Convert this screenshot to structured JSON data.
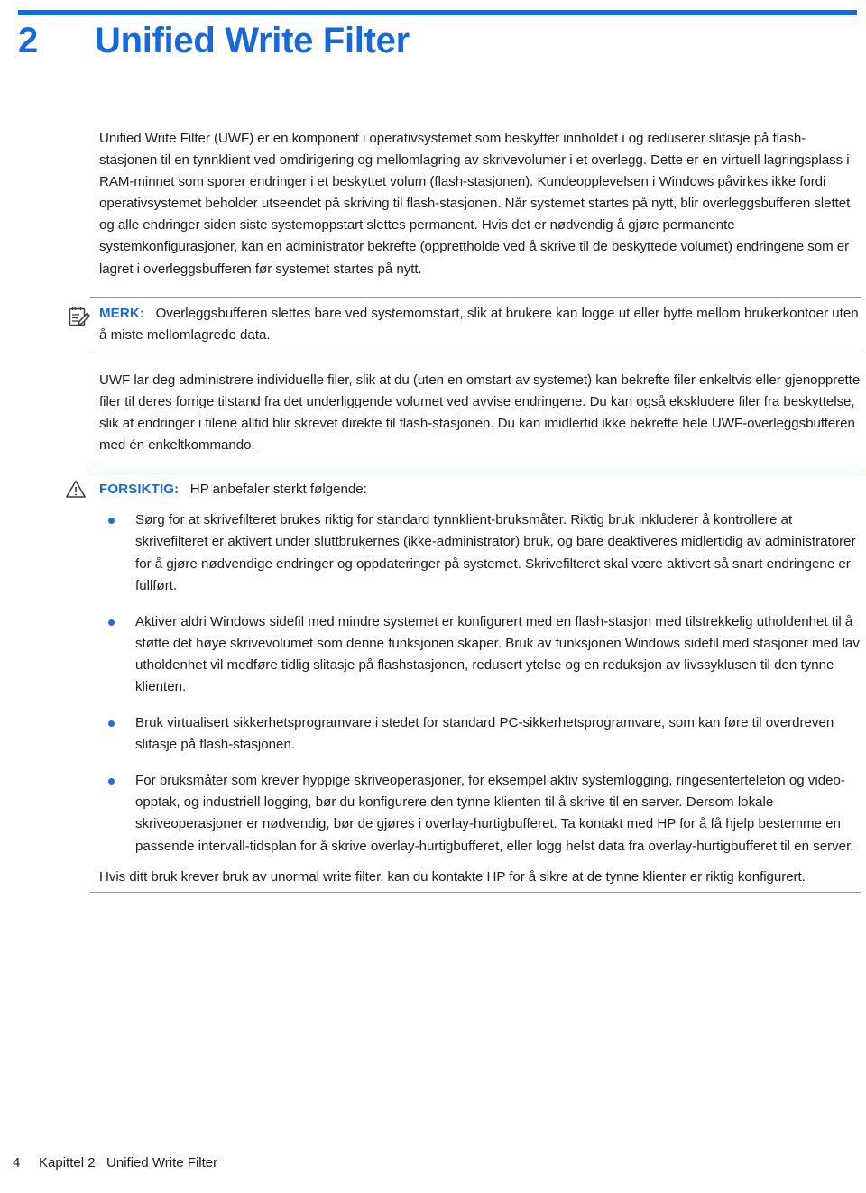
{
  "chapter": {
    "number": "2",
    "title": "Unified Write Filter",
    "rule_color": "#0d6ce8",
    "title_color": "#1668dc"
  },
  "body": {
    "intro_paragraph": "Unified Write Filter (UWF) er en komponent i operativsystemet som beskytter innholdet i og reduserer slitasje på flash-stasjonen til en tynnklient ved omdirigering og mellomlagring av skrivevolumer i et overlegg. Dette er en virtuell lagringsplass i RAM-minnet som sporer endringer i et beskyttet volum (flash-stasjonen). Kundeopplevelsen i Windows påvirkes ikke fordi operativsystemet beholder utseendet på skriving til flash-stasjonen. Når systemet startes på nytt, blir overleggsbufferen slettet og alle endringer siden siste systemoppstart slettes permanent. Hvis det er nødvendig å gjøre permanente systemkonfigurasjoner, kan en administrator bekrefte (opprettholde ved å skrive til de beskyttede volumet) endringene som er lagret i overleggsbufferen før systemet startes på nytt.",
    "uwf_paragraph": "UWF lar deg administrere individuelle filer, slik at du (uten en omstart av systemet) kan bekrefte filer enkeltvis eller gjenopprette filer til deres forrige tilstand fra det underliggende volumet ved avvise endringene. Du kan også ekskludere filer fra beskyttelse, slik at endringer i filene alltid blir skrevet direkte til flash-stasjonen. Du kan imidlertid ikke bekrefte hele UWF-overleggsbufferen med én enkeltkommando.",
    "closing_paragraph": "Hvis ditt bruk krever bruk av unormal write filter, kan du kontakte HP for å sikre at de tynne klienter er riktig konfigurert."
  },
  "note": {
    "icon": "note-pad-pencil-icon",
    "label": "MERK:",
    "text": "Overleggsbufferen slettes bare ved systemomstart, slik at brukere kan logge ut eller bytte mellom brukerkontoer uten å miste mellomlagrede data.",
    "label_color": "#1668dc",
    "rule_color": "#6f9fc8"
  },
  "caution": {
    "icon": "warning-triangle-icon",
    "label": "FORSIKTIG:",
    "text": "HP anbefaler sterkt følgende:",
    "label_color": "#1668dc",
    "rule_color": "#6f9fc8",
    "bullets": [
      "Sørg for at skrivefilteret brukes riktig for standard tynnklient-bruksmåter. Riktig bruk inkluderer å kontrollere at skrivefilteret er aktivert under sluttbrukernes (ikke-administrator) bruk, og bare deaktiveres midlertidig av administratorer for å gjøre nødvendige endringer og oppdateringer på systemet. Skrivefilteret skal være aktivert så snart endringene er fullført.",
      "Aktiver aldri Windows sidefil med mindre systemet er konfigurert med en flash-stasjon med tilstrekkelig utholdenhet til å støtte det høye skrivevolumet som denne funksjonen skaper. Bruk av funksjonen Windows sidefil med stasjoner med lav utholdenhet vil medføre tidlig slitasje på flashstasjonen, redusert ytelse og en reduksjon av livssyklusen til den tynne klienten.",
      "Bruk virtualisert sikkerhetsprogramvare i stedet for standard PC-sikkerhetsprogramvare, som kan føre til overdreven slitasje på flash-stasjonen.",
      "For bruksmåter som krever hyppige skriveoperasjoner, for eksempel aktiv systemlogging, ringesentertelefon og video-opptak, og industriell logging, bør du konfigurere den tynne klienten til å skrive til en server. Dersom lokale skriveoperasjoner er nødvendig, bør de gjøres i overlay-hurtigbufferet. Ta kontakt med HP for å få hjelp bestemme en passende intervall-tidsplan for å skrive overlay-hurtigbufferet, eller logg helst data fra overlay-hurtigbufferet til en server."
    ],
    "bullet_color": "#1f6fe0"
  },
  "footer": {
    "page_number": "4",
    "chapter_label": "Kapittel 2   Unified Write Filter"
  }
}
